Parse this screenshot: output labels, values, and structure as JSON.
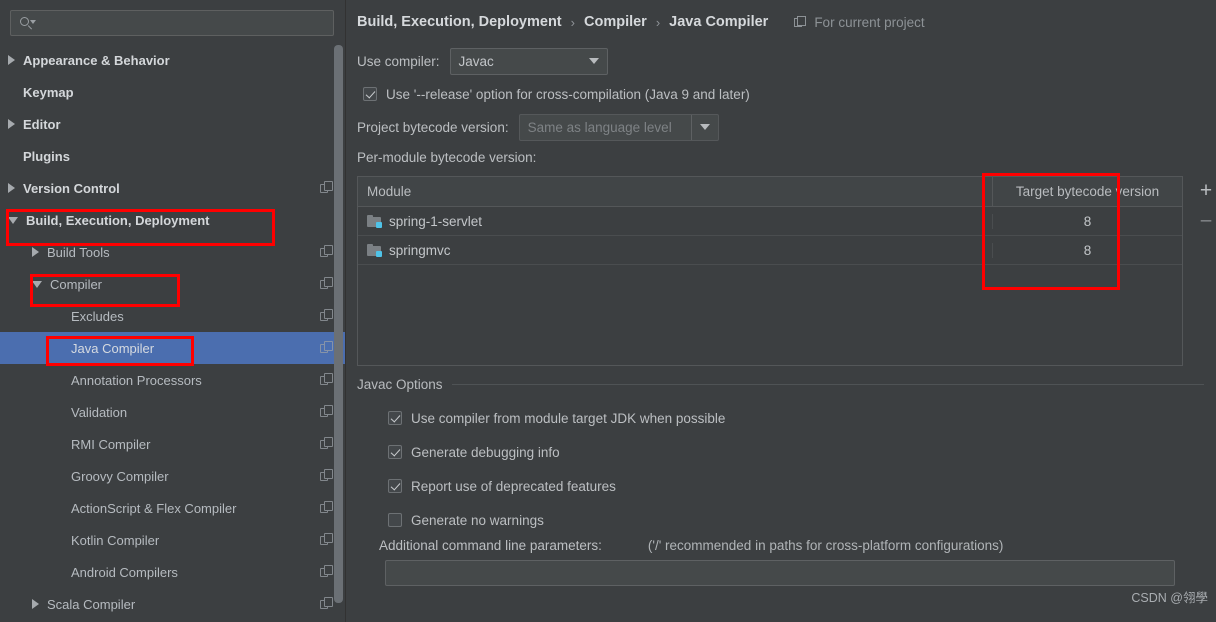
{
  "search": {
    "value": "",
    "placeholder": "",
    "icon": "search-icon"
  },
  "sidebar": {
    "items": [
      {
        "label": "Appearance & Behavior",
        "arrow": "right",
        "indent": 0,
        "bold": true,
        "copy": false,
        "selected": false
      },
      {
        "label": "Keymap",
        "arrow": "none",
        "indent": 0,
        "bold": true,
        "copy": false,
        "selected": false
      },
      {
        "label": "Editor",
        "arrow": "right",
        "indent": 0,
        "bold": true,
        "copy": false,
        "selected": false
      },
      {
        "label": "Plugins",
        "arrow": "none",
        "indent": 0,
        "bold": true,
        "copy": false,
        "selected": false
      },
      {
        "label": "Version Control",
        "arrow": "right",
        "indent": 0,
        "bold": true,
        "copy": true,
        "selected": false
      },
      {
        "label": "Build, Execution, Deployment",
        "arrow": "down",
        "indent": 0,
        "bold": true,
        "copy": false,
        "selected": false
      },
      {
        "label": "Build Tools",
        "arrow": "right",
        "indent": 1,
        "bold": false,
        "copy": true,
        "selected": false
      },
      {
        "label": "Compiler",
        "arrow": "down",
        "indent": 1,
        "bold": false,
        "copy": true,
        "selected": false
      },
      {
        "label": "Excludes",
        "arrow": "none",
        "indent": 2,
        "bold": false,
        "copy": true,
        "selected": false
      },
      {
        "label": "Java Compiler",
        "arrow": "none",
        "indent": 2,
        "bold": false,
        "copy": true,
        "selected": true
      },
      {
        "label": "Annotation Processors",
        "arrow": "none",
        "indent": 2,
        "bold": false,
        "copy": true,
        "selected": false
      },
      {
        "label": "Validation",
        "arrow": "none",
        "indent": 2,
        "bold": false,
        "copy": true,
        "selected": false
      },
      {
        "label": "RMI Compiler",
        "arrow": "none",
        "indent": 2,
        "bold": false,
        "copy": true,
        "selected": false
      },
      {
        "label": "Groovy Compiler",
        "arrow": "none",
        "indent": 2,
        "bold": false,
        "copy": true,
        "selected": false
      },
      {
        "label": "ActionScript & Flex Compiler",
        "arrow": "none",
        "indent": 2,
        "bold": false,
        "copy": true,
        "selected": false
      },
      {
        "label": "Kotlin Compiler",
        "arrow": "none",
        "indent": 2,
        "bold": false,
        "copy": true,
        "selected": false
      },
      {
        "label": "Android Compilers",
        "arrow": "none",
        "indent": 2,
        "bold": false,
        "copy": true,
        "selected": false
      },
      {
        "label": "Scala Compiler",
        "arrow": "right",
        "indent": 1,
        "bold": false,
        "copy": true,
        "selected": false
      }
    ]
  },
  "breadcrumb": {
    "crumb1": "Build, Execution, Deployment",
    "sep1": "›",
    "crumb2": "Compiler",
    "sep2": "›",
    "crumb3": "Java Compiler",
    "scope_label": "For current project"
  },
  "main": {
    "use_compiler_label": "Use compiler:",
    "use_compiler_value": "Javac",
    "release_option_label": "Use '--release' option for cross-compilation (Java 9 and later)",
    "release_option_checked": true,
    "project_bytecode_label": "Project bytecode version:",
    "project_bytecode_value": "Same as language level",
    "per_module_label": "Per-module bytecode version:",
    "add_button": "+",
    "remove_button": "–"
  },
  "table": {
    "headers": [
      "Module",
      "Target bytecode version"
    ],
    "rows": [
      {
        "module": "spring-1-servlet",
        "target": "8"
      },
      {
        "module": "springmvc",
        "target": "8"
      }
    ]
  },
  "javac": {
    "group_title": "Javac Options",
    "options": [
      {
        "label": "Use compiler from module target JDK when possible",
        "checked": true
      },
      {
        "label": "Generate debugging info",
        "checked": true
      },
      {
        "label": "Report use of deprecated features",
        "checked": true
      },
      {
        "label": "Generate no warnings",
        "checked": false
      }
    ],
    "params_label": "Additional command line parameters:",
    "params_note": "('/' recommended in paths for cross-platform configurations)",
    "params_value": ""
  },
  "watermark": "CSDN @翎學",
  "colors": {
    "background": "#3c3f41",
    "selection": "#4b6eaf",
    "annotation": "#ff0000",
    "module_badge": "#4fc3e8"
  }
}
